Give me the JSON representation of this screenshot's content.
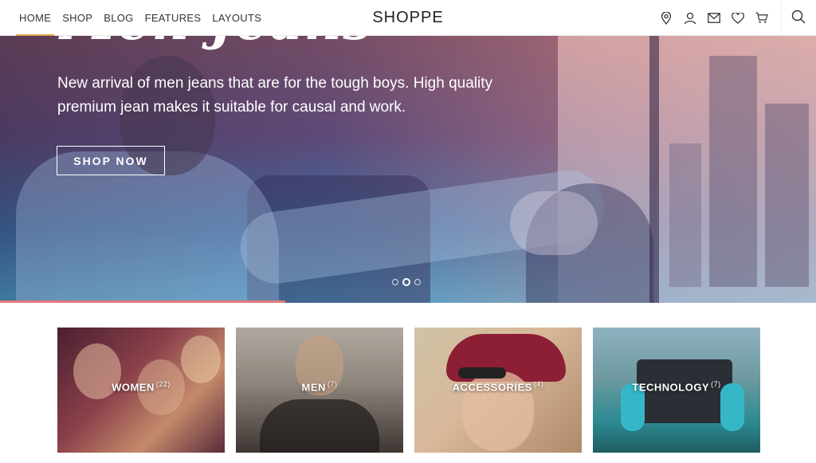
{
  "nav": {
    "links": [
      {
        "label": "HOME",
        "active": true
      },
      {
        "label": "SHOP",
        "active": false
      },
      {
        "label": "BLOG",
        "active": false
      },
      {
        "label": "FEATURES",
        "active": false
      },
      {
        "label": "LAYOUTS",
        "active": false
      }
    ],
    "brand": "SHOPPE",
    "icons": [
      "map-pin-icon",
      "user-icon",
      "mail-icon",
      "heart-icon",
      "cart-icon",
      "search-icon"
    ],
    "accent": "#e3a64a"
  },
  "hero": {
    "script_title": "Men Jeans",
    "description": "New arrival of men jeans that are for the tough boys. High quality premium jean makes it suitable for causal and work.",
    "button_label": "SHOP NOW",
    "slides": 3,
    "active_slide": 2,
    "progress": 0.35,
    "progress_color": "#e07a7a"
  },
  "categories": [
    {
      "name": "WOMEN",
      "count": "(22)"
    },
    {
      "name": "MEN",
      "count": "(7)"
    },
    {
      "name": "ACCESSORIES",
      "count": "(4)"
    },
    {
      "name": "TECHNOLOGY",
      "count": "(7)"
    }
  ]
}
